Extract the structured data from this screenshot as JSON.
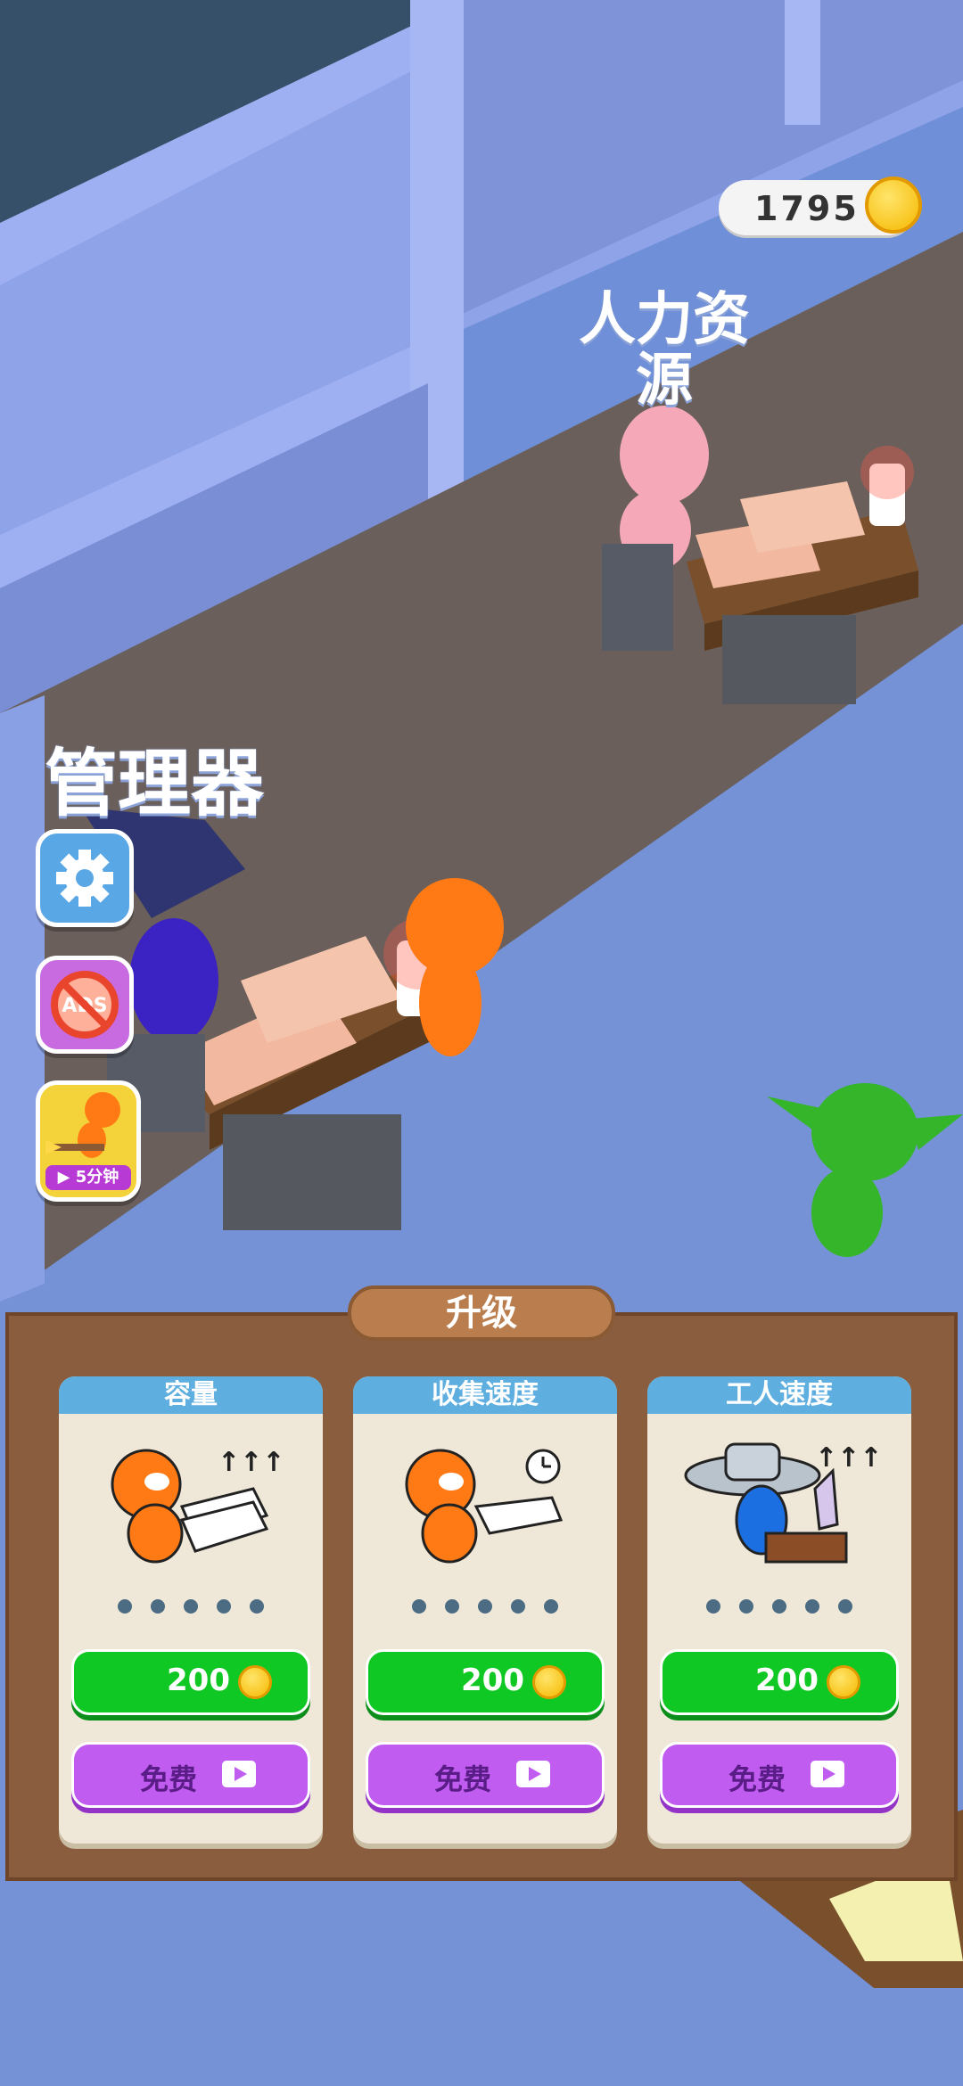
{
  "hud": {
    "coins": "1795"
  },
  "world": {
    "hr_room_label": "人力资源",
    "manager_label": "管理器"
  },
  "side_buttons": {
    "booster_timer": "5分钟",
    "noads_text": "ADS"
  },
  "upgrade_panel": {
    "title": "升级",
    "cards": [
      {
        "title": "容量",
        "price": "200",
        "free_label": "免费",
        "level_dots": 5
      },
      {
        "title": "收集速度",
        "price": "200",
        "free_label": "免费",
        "level_dots": 5
      },
      {
        "title": "工人速度",
        "price": "200",
        "free_label": "免费",
        "level_dots": 5
      }
    ]
  },
  "colors": {
    "card_header": "#5eaee0",
    "price_button": "#10c823",
    "free_button": "#c15cf0",
    "panel": "#8a5d3e"
  }
}
